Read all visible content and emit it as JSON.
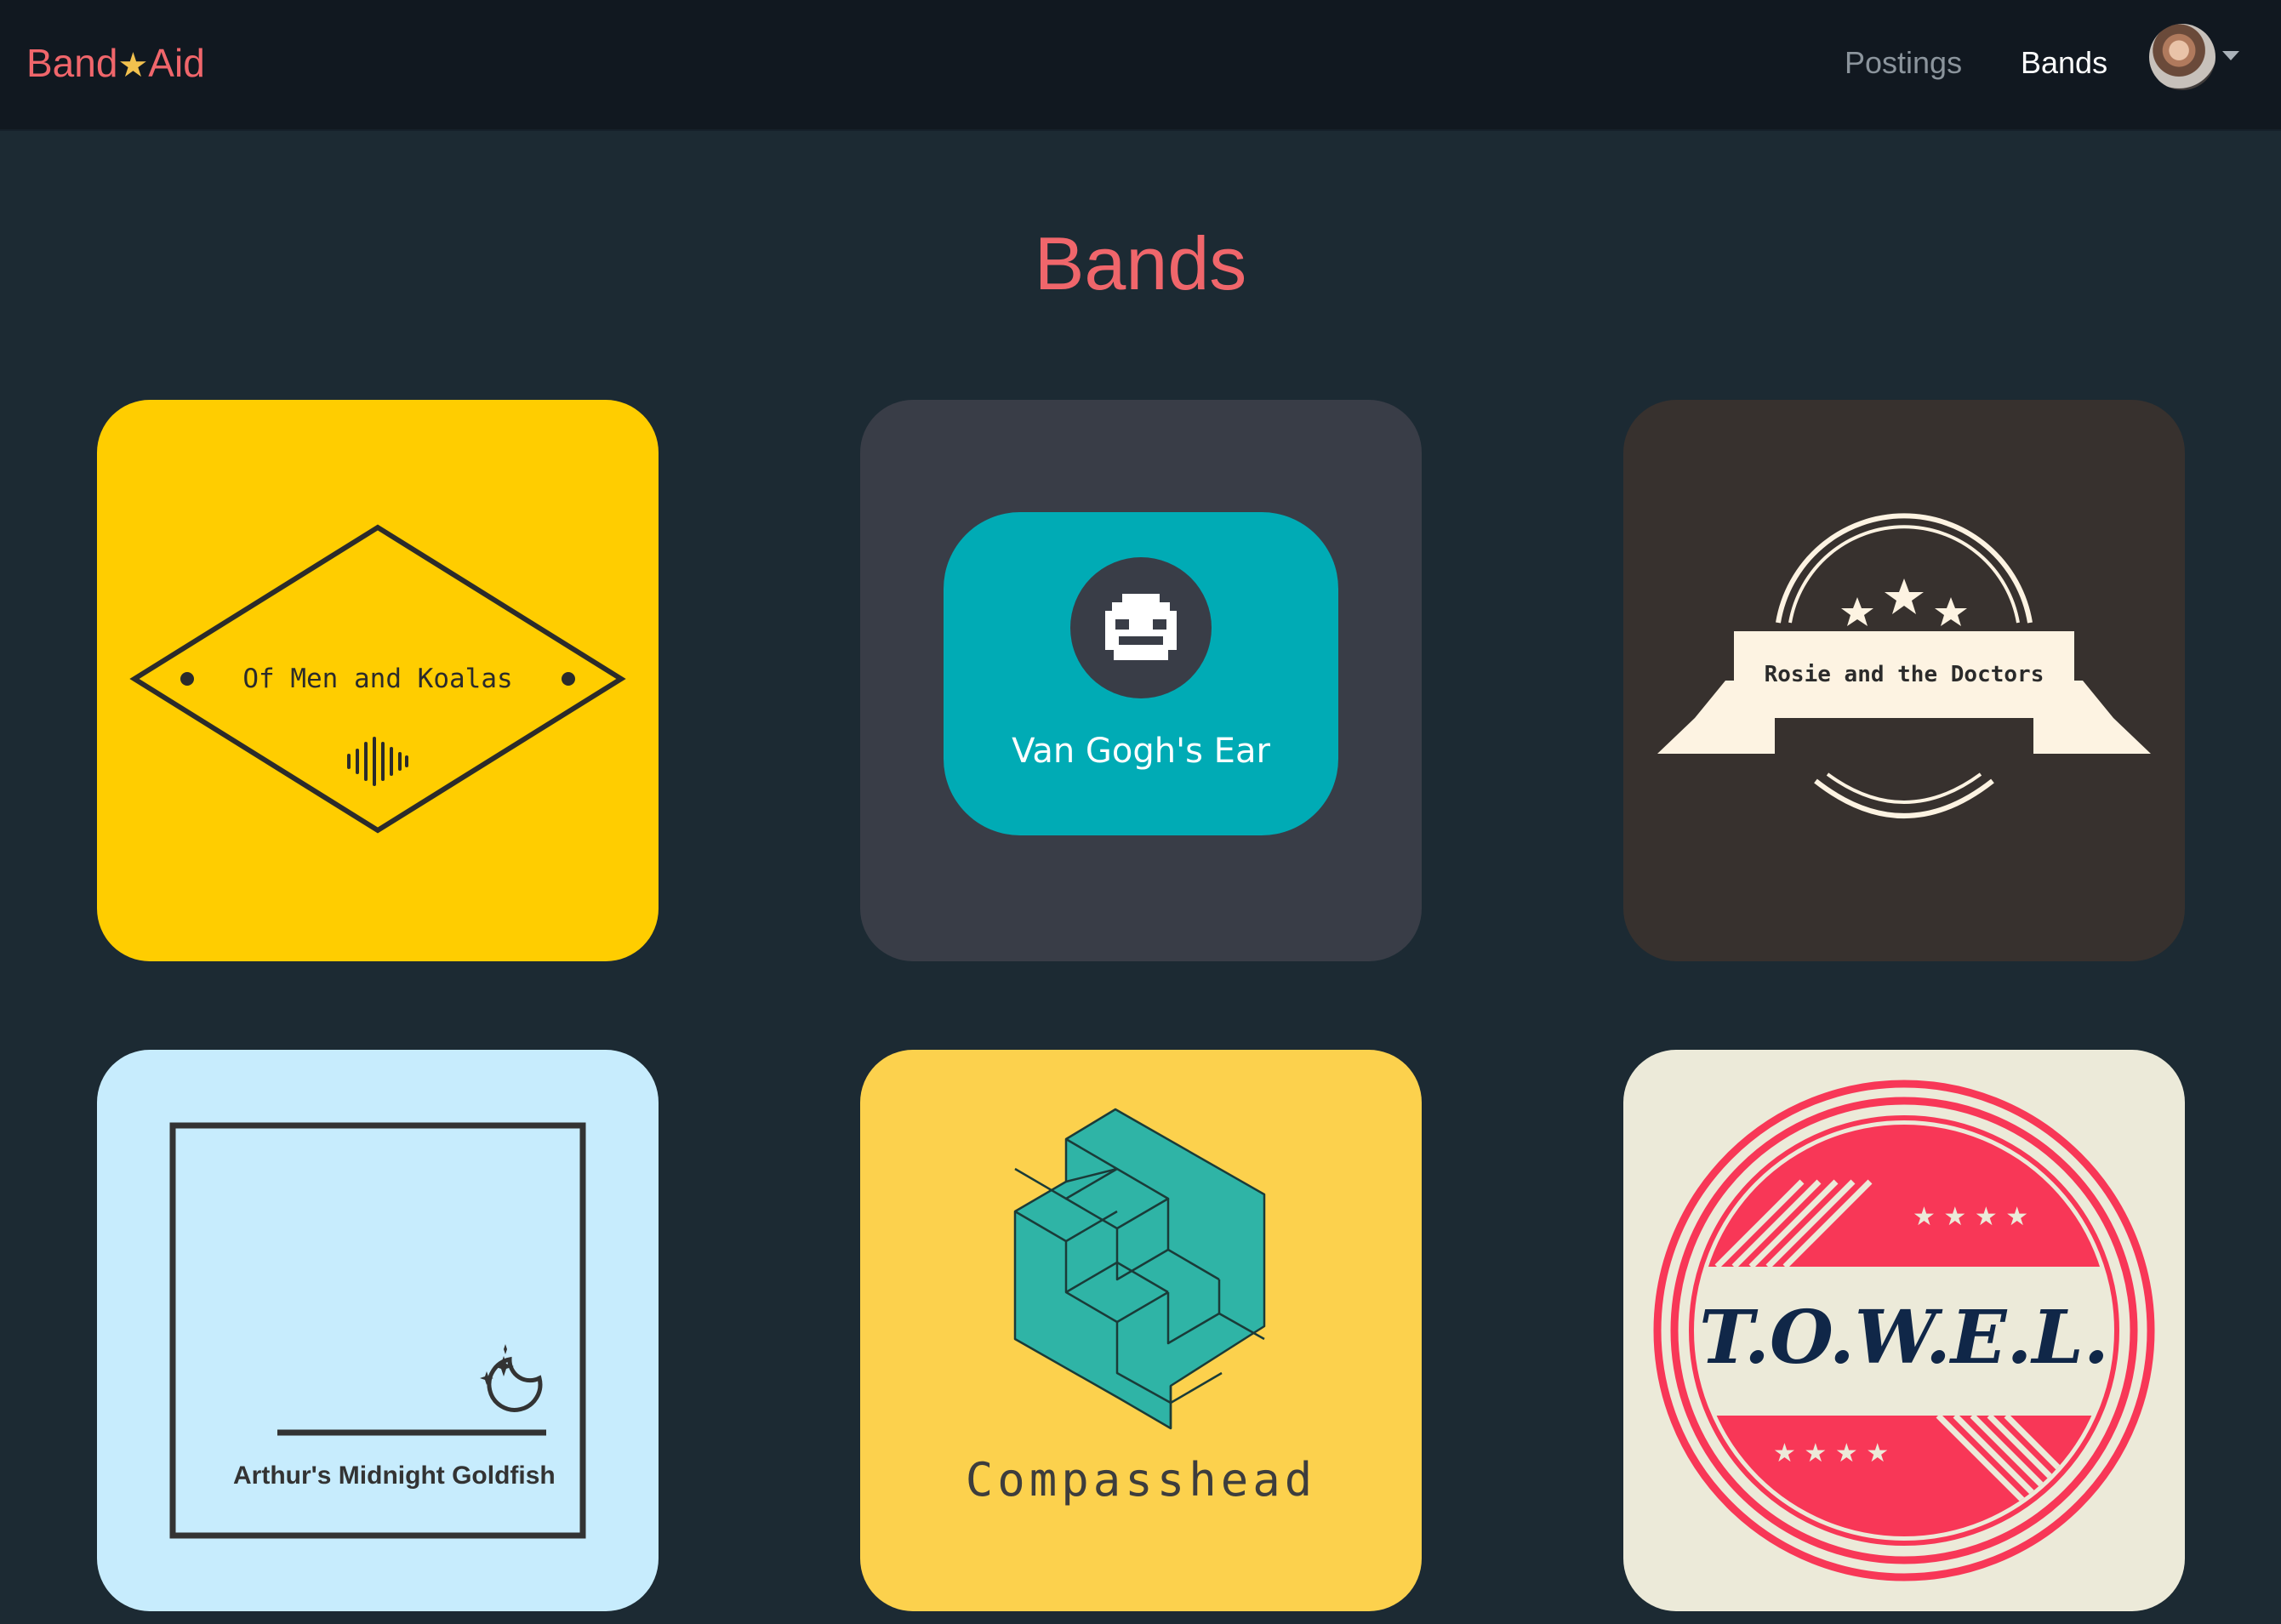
{
  "navbar": {
    "brand_left": "Band",
    "brand_star": "★",
    "brand_right": "Aid",
    "links": [
      "Postings",
      "Bands"
    ],
    "user_menu": "avatar with dropdown caret"
  },
  "page": {
    "title": "Bands"
  },
  "bands": [
    {
      "name": "Of Men and Koalas",
      "bg": "#ffcd00",
      "logo": "diamond-soundwave-icon"
    },
    {
      "name": "Van Gogh's Ear",
      "bg": "#393d47",
      "accent": "#00abb5",
      "logo": "pixel-face-icon"
    },
    {
      "name": "Rosie and the Doctors",
      "bg": "#37312e",
      "accent": "#fdf3e2",
      "logo": "ribbon-stars-icon"
    },
    {
      "name": "Arthur's Midnight Goldfish",
      "bg": "#c7ecfd",
      "logo": "moon-stars-icon"
    },
    {
      "name": "Compasshead",
      "bg": "#fcd14d",
      "accent": "#2fb4a6",
      "logo": "isometric-cubes-icon"
    },
    {
      "name": "T.O.W.E.L.",
      "bg": "#ecead9",
      "accent": "#f83757",
      "logo": "circle-stripes-stars-icon"
    }
  ],
  "colors": {
    "page_bg": "#1c2a33",
    "navbar_bg": "#111820",
    "brand_red": "#f0666b"
  }
}
